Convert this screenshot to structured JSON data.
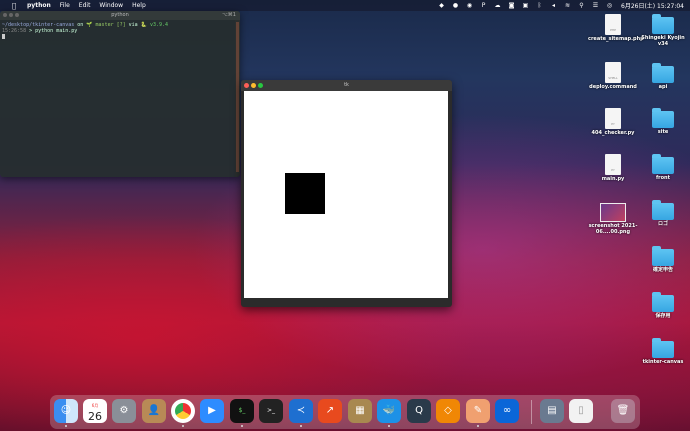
{
  "menubar": {
    "app_name": "python",
    "items": [
      "File",
      "Edit",
      "Window",
      "Help"
    ],
    "clock": "6月26日(土)  15:27:04"
  },
  "terminal": {
    "title": "python",
    "title_right": "⌥⌘1",
    "line1_path": "~/desktop/tkinter-canvas",
    "line1_on": " on ",
    "line1_git": "🌱 master [?]",
    "line1_via": " via ",
    "line1_ver": "🐍 v3.9.4",
    "line2_time": "15:26:58",
    "line2_cmd": " > python main.py"
  },
  "tk_window": {
    "title": "tk"
  },
  "desktop_icons": [
    {
      "label": "create_sitemap.php",
      "kind": "doc",
      "ext": "PHP"
    },
    {
      "label": "Shingeki Kyojin v34",
      "kind": "folder"
    },
    {
      "label": "deploy.command",
      "kind": "doc",
      "ext": "SHELL"
    },
    {
      "label": "api",
      "kind": "folder"
    },
    {
      "label": "404_checker.py",
      "kind": "doc",
      "ext": "PY"
    },
    {
      "label": "site",
      "kind": "folder"
    },
    {
      "label": "main.py",
      "kind": "doc",
      "ext": "PY"
    },
    {
      "label": "front",
      "kind": "folder"
    },
    {
      "label": "screenshot 2021-06....00.png",
      "kind": "image"
    },
    {
      "label": "ロゴ",
      "kind": "folder"
    },
    {
      "label": "確定申告",
      "kind": "folder"
    },
    {
      "label": "保存用",
      "kind": "folder"
    },
    {
      "label": "tkinter-canvas",
      "kind": "folder"
    }
  ],
  "dock": {
    "calendar_day": "26",
    "calendar_month": "6月",
    "apps": [
      "finder-icon",
      "calendar-icon",
      "system-preferences-icon",
      "contacts-icon",
      "chrome-icon",
      "zoom-icon",
      "iterm-icon",
      "terminal-icon",
      "vscode-icon",
      "activity-icon",
      "archive-icon",
      "docker-icon",
      "quicktime-icon",
      "drawio-icon",
      "notes-icon",
      "infinity-icon",
      "preview-icon",
      "document-icon",
      "trash-icon"
    ]
  }
}
